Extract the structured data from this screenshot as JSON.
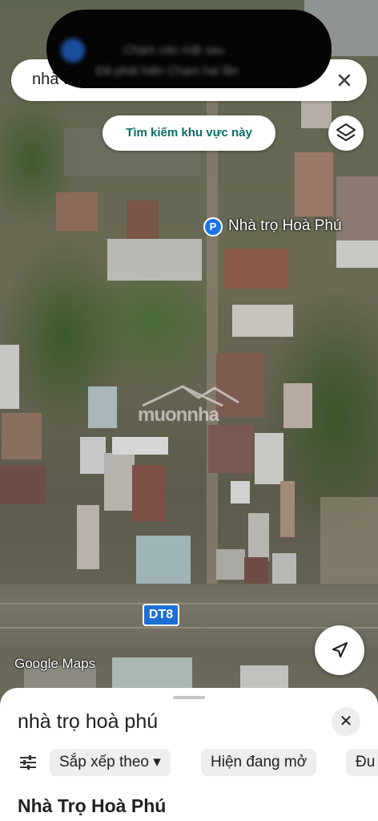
{
  "notification": {
    "line1": "Chạm vào mặt sau",
    "line2": "Đã phát hiện Chạm hai lần"
  },
  "search": {
    "query": "nhà trọ hoà phú"
  },
  "map": {
    "search_area_label": "Tìm kiếm khu vực này",
    "place_pin_letter": "P",
    "place_label": "Nhà trọ Hoà Phú",
    "road_shield": "DT8",
    "attribution": "Google Maps",
    "watermark": "muonnha"
  },
  "sheet": {
    "query": "nhà trọ hoà phú",
    "close_symbol": "✕",
    "chips": [
      "Sắp xếp theo ▾",
      "Hiện đang mở",
      "Đu"
    ],
    "first_result": "Nhà Trọ Hoà Phú"
  },
  "icons": {
    "close": "close-icon",
    "layers": "layers-icon",
    "navigation": "navigation-arrow-icon",
    "filter": "tune-icon"
  }
}
